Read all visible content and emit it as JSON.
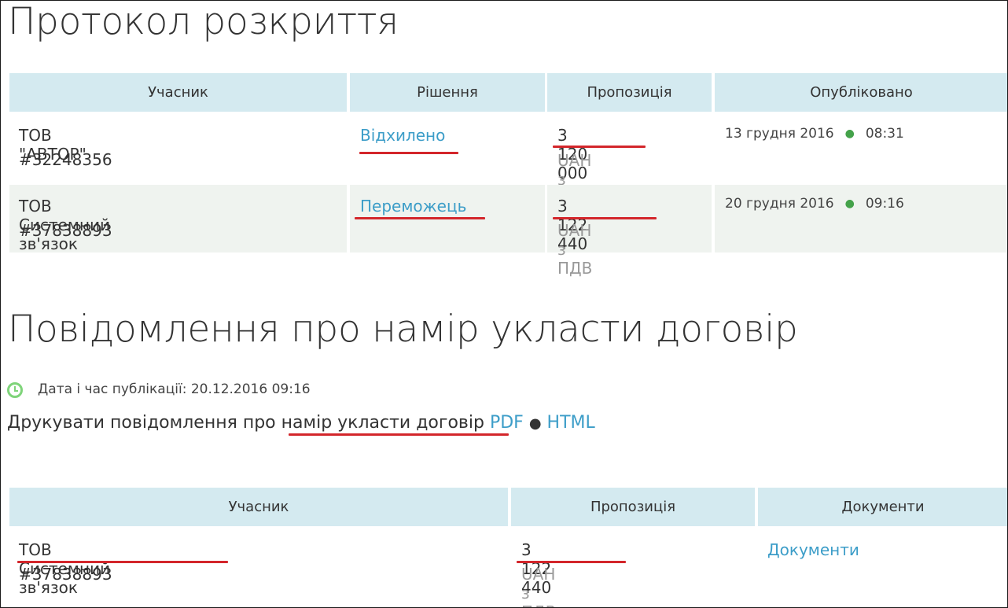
{
  "disclosure": {
    "title": "Протокол розкриття",
    "columns": [
      "Учасник",
      "Рішення",
      "Пропозиція",
      "Опубліковано"
    ],
    "rows": [
      {
        "participant": "ТОВ \"АВТОР\"",
        "code": "#32248356",
        "decision": "Відхилено",
        "amount": "3 120 000",
        "currency": "UAH з ПДВ",
        "date": "13 грудня 2016",
        "time": "08:31"
      },
      {
        "participant": "ТОВ Системний зв'язок",
        "code": "#37838893",
        "decision": "Переможець",
        "amount": "3 122 440",
        "currency": "UAH з ПДВ",
        "date": "20 грудня 2016",
        "time": "09:16"
      }
    ]
  },
  "notice": {
    "title": "Повідомлення про намір укласти договір",
    "published_label": "Дата і час публікації: 20.12.2016 09:16",
    "print_prefix": "Друкувати повідомлення про",
    "print_subject": "намір укласти договір",
    "pdf_link": "PDF",
    "separator": "●",
    "html_link": "HTML",
    "columns": [
      "Учасник",
      "Пропозиція",
      "Документи"
    ],
    "row": {
      "participant": "ТОВ Системний зв'язок",
      "code": "#37838893",
      "amount": "3 122 440",
      "currency": "UAH з ПДВ",
      "documents": "Документи"
    }
  },
  "icons": {
    "published_clock": "clock-icon",
    "time_separator": "bullet-dot-icon"
  },
  "colors": {
    "header_bg": "#d4eaf0",
    "alt_row_bg": "#eff3ef",
    "link": "#3c9dc8",
    "annotation_underline": "#d3262b",
    "clock": "#7fd47a"
  }
}
